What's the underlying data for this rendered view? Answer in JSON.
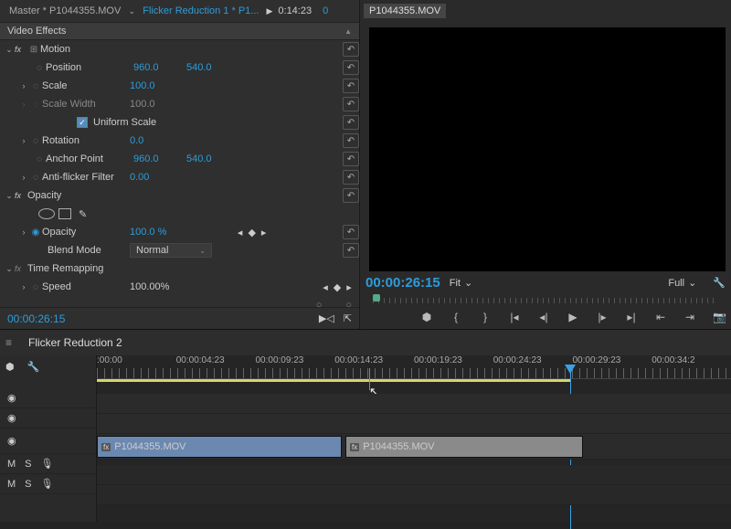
{
  "tabs": {
    "master": "Master * P1044355.MOV",
    "effect": "Flicker Reduction 1 * P1...",
    "timecode": "0:14:23",
    "frame": "0"
  },
  "section": {
    "video_effects": "Video Effects"
  },
  "source_clip": "P1044355.MOV",
  "motion": {
    "label": "Motion",
    "position": {
      "label": "Position",
      "x": "960.0",
      "y": "540.0"
    },
    "scale": {
      "label": "Scale",
      "value": "100.0"
    },
    "scale_width": {
      "label": "Scale Width",
      "value": "100.0"
    },
    "uniform": {
      "label": "Uniform Scale"
    },
    "rotation": {
      "label": "Rotation",
      "value": "0.0"
    },
    "anchor": {
      "label": "Anchor Point",
      "x": "960.0",
      "y": "540.0"
    },
    "antiflicker": {
      "label": "Anti-flicker Filter",
      "value": "0.00"
    }
  },
  "opacity": {
    "label": "Opacity",
    "opacity": {
      "label": "Opacity",
      "value": "100.0 %"
    },
    "blend": {
      "label": "Blend Mode",
      "value": "Normal"
    }
  },
  "time_remap": {
    "label": "Time Remapping",
    "speed": {
      "label": "Speed",
      "value": "100.00%"
    }
  },
  "footer_tc": "00:00:26:15",
  "viewer": {
    "timecode": "00:00:26:15",
    "zoom": "Fit",
    "res": "Full"
  },
  "sequence": {
    "name": "Flicker Reduction 2"
  },
  "ruler": [
    ":00:00",
    "00:00:04:23",
    "00:00:09:23",
    "00:00:14:23",
    "00:00:19:23",
    "00:00:24:23",
    "00:00:29:23",
    "00:00:34:2"
  ],
  "clips": {
    "a": "P1044355.MOV",
    "b": "P1044355.MOV"
  },
  "track_audio": {
    "m": "M",
    "s": "S"
  }
}
